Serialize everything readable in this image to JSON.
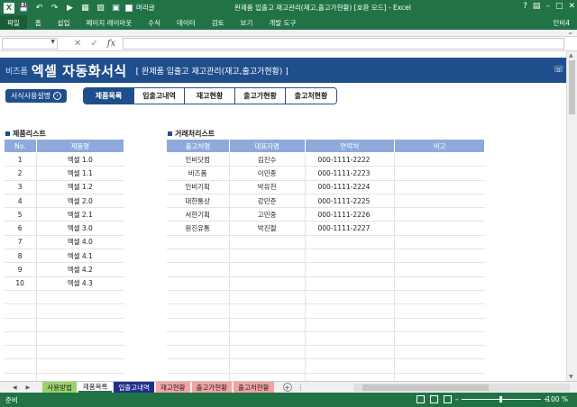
{
  "window": {
    "title": "완제품 입출고 재고관리(재고,출고가현황) [호환 모드] - Excel",
    "quick_access": {
      "checkbox_label": "머리글"
    }
  },
  "ribbon": {
    "file_tab": "파일",
    "tabs": [
      "홈",
      "삽입",
      "페이지 레이아웃",
      "수식",
      "데이터",
      "검토",
      "보기",
      "개발 도구"
    ],
    "user": "인비4"
  },
  "formula_bar": {
    "fx_label": "fx",
    "name_box": "",
    "content": ""
  },
  "banner": {
    "brand": "비즈폼",
    "title": "엑셀 자동화서식",
    "subtitle": "[ 완제품 입출고 재고관리(재고,출고가현황) ]",
    "bg_color": "#1f4e8c"
  },
  "guide_button": {
    "label": "서식사용설명"
  },
  "nav_tabs": [
    {
      "label": "제품목록",
      "active": true
    },
    {
      "label": "입출고내역",
      "active": false
    },
    {
      "label": "재고현황",
      "active": false
    },
    {
      "label": "출고가현황",
      "active": false
    },
    {
      "label": "출고처현황",
      "active": false
    }
  ],
  "product_list": {
    "title": "제품리스트",
    "headers": [
      "No.",
      "제품명"
    ],
    "rows": [
      [
        "1",
        "엑셀 1.0"
      ],
      [
        "2",
        "엑셀 1.1"
      ],
      [
        "3",
        "엑셀 1.2"
      ],
      [
        "4",
        "엑셀 2.0"
      ],
      [
        "5",
        "엑셀 2.1"
      ],
      [
        "6",
        "엑셀 3.0"
      ],
      [
        "7",
        "엑셀 4.0"
      ],
      [
        "8",
        "엑셀 4.1"
      ],
      [
        "9",
        "엑셀 4.2"
      ],
      [
        "10",
        "엑셀 4.3"
      ],
      [
        "",
        ""
      ],
      [
        "",
        ""
      ],
      [
        "",
        ""
      ],
      [
        "",
        ""
      ],
      [
        "",
        ""
      ],
      [
        "",
        ""
      ],
      [
        "",
        ""
      ]
    ]
  },
  "client_list": {
    "title": "거래처리스트",
    "headers": [
      "출고처명",
      "대표자명",
      "연락처",
      "비고"
    ],
    "rows": [
      [
        "인비닷컴",
        "김진수",
        "000-1111-2222",
        ""
      ],
      [
        "비즈폼",
        "이민종",
        "000-1111-2223",
        ""
      ],
      [
        "인비기획",
        "박유천",
        "000-1111-2224",
        ""
      ],
      [
        "대한통상",
        "강민준",
        "000-1111-2225",
        ""
      ],
      [
        "서한기획",
        "고민중",
        "000-1111-2226",
        ""
      ],
      [
        "원진유통",
        "박진절",
        "000-1111-2227",
        ""
      ],
      [
        "",
        "",
        "",
        ""
      ],
      [
        "",
        "",
        "",
        ""
      ],
      [
        "",
        "",
        "",
        ""
      ],
      [
        "",
        "",
        "",
        ""
      ],
      [
        "",
        "",
        "",
        ""
      ],
      [
        "",
        "",
        "",
        ""
      ],
      [
        "",
        "",
        "",
        ""
      ],
      [
        "",
        "",
        "",
        ""
      ],
      [
        "",
        "",
        "",
        ""
      ],
      [
        "",
        "",
        "",
        ""
      ],
      [
        "",
        "",
        "",
        ""
      ]
    ]
  },
  "sheet_tabs": [
    {
      "label": "사용방법",
      "bg": "#9bd36b",
      "color": "#222"
    },
    {
      "label": "제품목록",
      "bg": "#ffffff",
      "color": "#222",
      "active": true
    },
    {
      "label": "입출고내역",
      "bg": "#1f2e8c",
      "color": "#ffffff"
    },
    {
      "label": "재고현황",
      "bg": "#f4a3a3",
      "color": "#222"
    },
    {
      "label": "출고가현황",
      "bg": "#f4a3a3",
      "color": "#222"
    },
    {
      "label": "출고처현황",
      "bg": "#f4a3a3",
      "color": "#222"
    }
  ],
  "status_bar": {
    "ready": "준비",
    "zoom": "100 %"
  },
  "icons": {
    "save": "save-icon",
    "undo": "undo-icon",
    "redo": "redo-icon",
    "cancel": "cancel-icon",
    "enter": "enter-icon",
    "phone": "phone-icon"
  }
}
